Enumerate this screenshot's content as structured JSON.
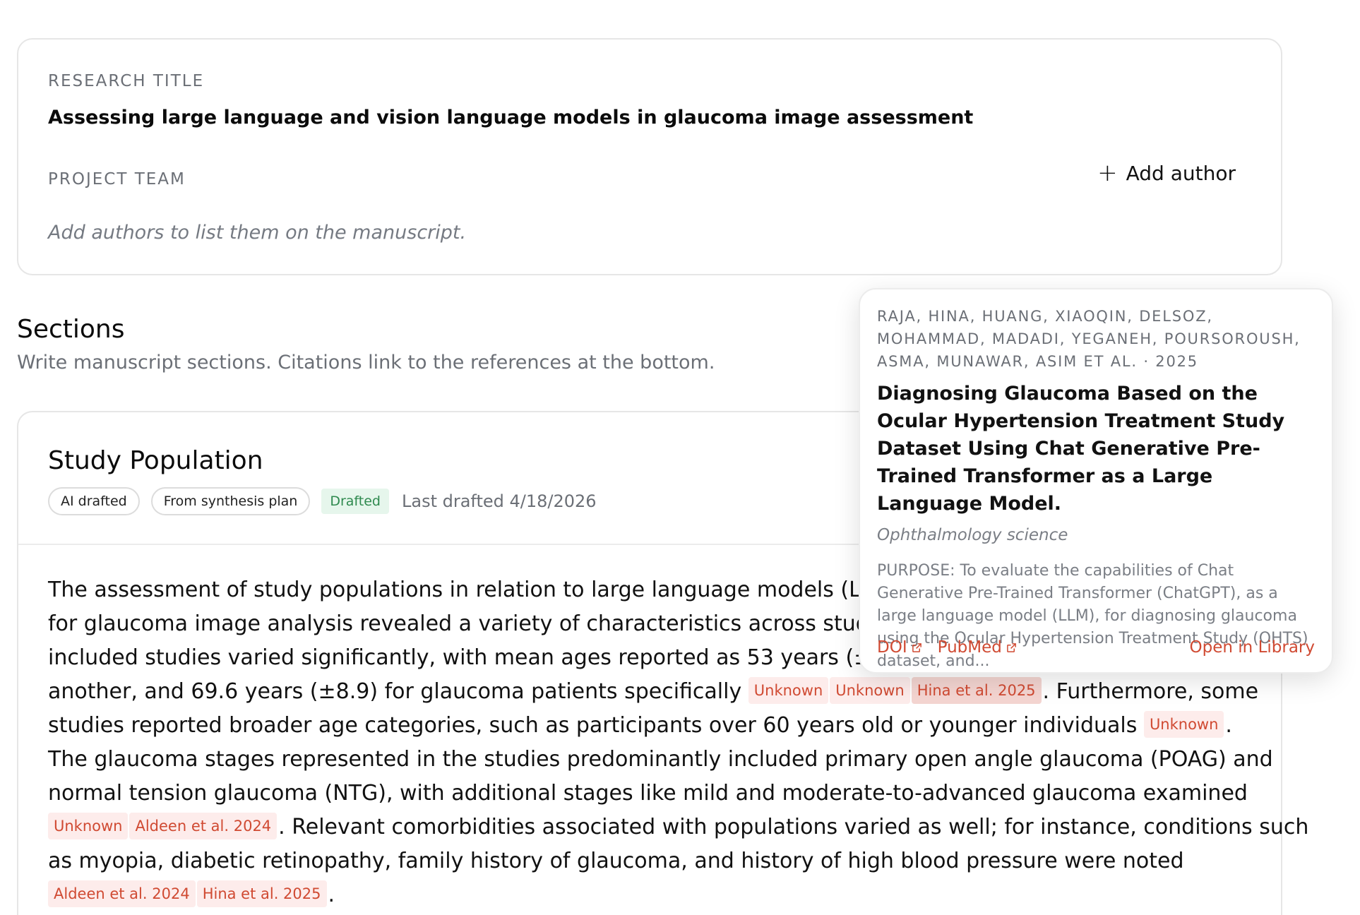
{
  "research": {
    "title_label": "RESEARCH TITLE",
    "title": "Assessing large language and vision language models in glaucoma image assessment",
    "team_label": "PROJECT TEAM",
    "add_author_label": "Add author",
    "authors_hint": "Add authors to list them on the manuscript."
  },
  "sections": {
    "heading": "Sections",
    "subheading": "Write manuscript sections. Citations link to the references at the bottom."
  },
  "section": {
    "title": "Study Population",
    "badges": [
      "AI drafted",
      "From synthesis plan"
    ],
    "status": "Drafted",
    "last_drafted": "Last drafted 4/18/2026",
    "lines": [
      {
        "text": "The assessment of study populations in relation to large language models (LLMs)"
      },
      {
        "text": "for glaucoma image analysis revealed a variety of characteristics across studies."
      },
      {
        "text": "included studies varied significantly, with mean ages reported as 53 years (±14)"
      },
      {
        "text": "another, and 69.6 years (±8.9) for glaucoma patients specifically ",
        "cites": [
          "Unknown",
          "Unknown",
          "Hina et al. 2025"
        ],
        "after": ". Furthermore, some"
      },
      {
        "text": "studies reported broader age categories, such as participants over 60 years old or younger individuals ",
        "cites": [
          "Unknown"
        ],
        "after": "."
      },
      {
        "text": "The glaucoma stages represented in the studies predominantly included primary open angle glaucoma (POAG) and"
      },
      {
        "text": "normal tension glaucoma (NTG), with additional stages like mild and moderate-to-advanced glaucoma examined"
      },
      {
        "text": "",
        "cites": [
          "Unknown",
          "Aldeen et al. 2024"
        ],
        "after": ". Relevant comorbidities associated with populations varied as well; for instance, conditions such"
      },
      {
        "text": "as myopia, diabetic retinopathy, family history of glaucoma, and history of high blood pressure were noted"
      },
      {
        "text": "",
        "cites": [
          "Aldeen et al. 2024",
          "Hina et al. 2025"
        ],
        "after": "."
      }
    ]
  },
  "popover": {
    "authors": "RAJA, HINA, HUANG, XIAOQIN, DELSOZ, MOHAMMAD, MADADI, YEGANEH, POURSOROUSH, ASMA, MUNAWAR, ASIM ET AL. · 2025",
    "title": "Diagnosing Glaucoma Based on the Ocular Hypertension Treatment Study Dataset Using Chat Generative Pre-Trained Transformer as a Large Language Model.",
    "journal": "Ophthalmology science",
    "abstract": "PURPOSE: To evaluate the capabilities of Chat Generative Pre-Trained Transformer (ChatGPT), as a large language model (LLM), for diagnosing glaucoma using the Ocular Hypertension Treatment Study (OHTS) dataset, and...",
    "doi_label": "DOI",
    "pubmed_label": "PubMed",
    "open_label": "Open in Library"
  },
  "colors": {
    "accent": "#d04a32",
    "cite_bg": "#fdeceb",
    "drafted_bg": "#e6f6ec",
    "drafted_text": "#2f8a4f"
  }
}
